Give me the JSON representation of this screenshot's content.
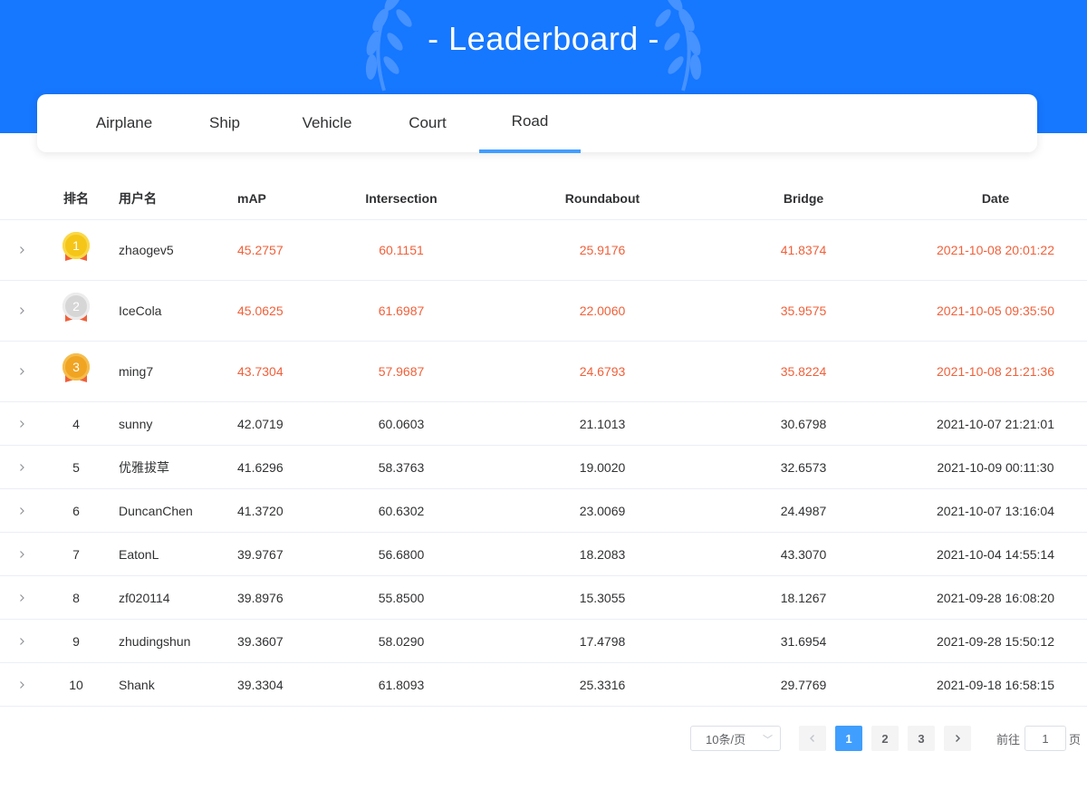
{
  "header": {
    "title": "- Leaderboard -",
    "background": "#1677ff"
  },
  "tabs": [
    {
      "label": "Airplane",
      "active": false
    },
    {
      "label": "Ship",
      "active": false
    },
    {
      "label": "Vehicle",
      "active": false
    },
    {
      "label": "Court",
      "active": false
    },
    {
      "label": "Road",
      "active": true
    }
  ],
  "table": {
    "columns": [
      "排名",
      "用户名",
      "mAP",
      "Intersection",
      "Roundabout",
      "Bridge",
      "Date"
    ],
    "highlight_color": "#f0603a",
    "rows": [
      {
        "rank": "1",
        "user": "zhaogev5",
        "map": "45.2757",
        "intersection": "60.1151",
        "roundabout": "25.9176",
        "bridge": "41.8374",
        "date": "2021-10-08 20:01:22"
      },
      {
        "rank": "2",
        "user": "IceCola",
        "map": "45.0625",
        "intersection": "61.6987",
        "roundabout": "22.0060",
        "bridge": "35.9575",
        "date": "2021-10-05 09:35:50"
      },
      {
        "rank": "3",
        "user": "ming7",
        "map": "43.7304",
        "intersection": "57.9687",
        "roundabout": "24.6793",
        "bridge": "35.8224",
        "date": "2021-10-08 21:21:36"
      },
      {
        "rank": "4",
        "user": "sunny",
        "map": "42.0719",
        "intersection": "60.0603",
        "roundabout": "21.1013",
        "bridge": "30.6798",
        "date": "2021-10-07 21:21:01"
      },
      {
        "rank": "5",
        "user": "优雅拔草",
        "map": "41.6296",
        "intersection": "58.3763",
        "roundabout": "19.0020",
        "bridge": "32.6573",
        "date": "2021-10-09 00:11:30"
      },
      {
        "rank": "6",
        "user": "DuncanChen",
        "map": "41.3720",
        "intersection": "60.6302",
        "roundabout": "23.0069",
        "bridge": "24.4987",
        "date": "2021-10-07 13:16:04"
      },
      {
        "rank": "7",
        "user": "EatonL",
        "map": "39.9767",
        "intersection": "56.6800",
        "roundabout": "18.2083",
        "bridge": "43.3070",
        "date": "2021-10-04 14:55:14"
      },
      {
        "rank": "8",
        "user": "zf020114",
        "map": "39.8976",
        "intersection": "55.8500",
        "roundabout": "15.3055",
        "bridge": "18.1267",
        "date": "2021-09-28 16:08:20"
      },
      {
        "rank": "9",
        "user": "zhudingshun",
        "map": "39.3607",
        "intersection": "58.0290",
        "roundabout": "17.4798",
        "bridge": "31.6954",
        "date": "2021-09-28 15:50:12"
      },
      {
        "rank": "10",
        "user": "Shank",
        "map": "39.3304",
        "intersection": "61.8093",
        "roundabout": "25.3316",
        "bridge": "29.7769",
        "date": "2021-09-18 16:58:15"
      }
    ]
  },
  "pagination": {
    "page_size": "10条/页",
    "pages": [
      "1",
      "2",
      "3"
    ],
    "current": "1",
    "goto_label": "前往",
    "goto_value": "1",
    "page_unit": "页"
  },
  "icons": {
    "expand": "chevron-right-icon",
    "prev": "chevron-left-icon",
    "next": "chevron-right-icon",
    "select": "chevron-down-icon"
  }
}
